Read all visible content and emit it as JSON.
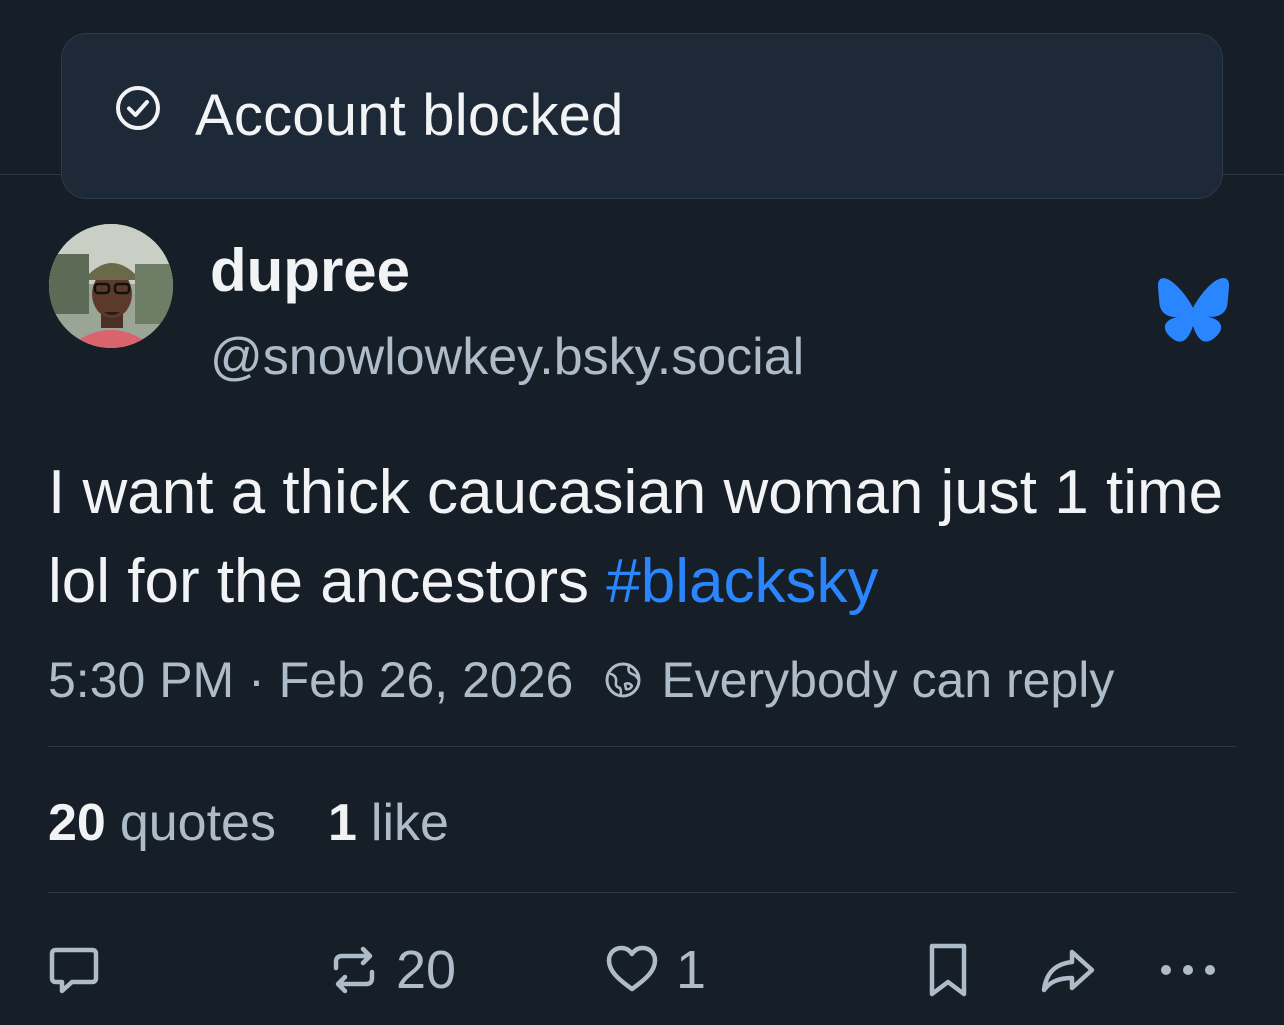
{
  "toast": {
    "icon": "check-circle-icon",
    "text": "Account blocked"
  },
  "author": {
    "display_name": "dupree",
    "handle": "@snowlowkey.bsky.social",
    "avatar": "avatar"
  },
  "brand": {
    "icon": "bluesky-butterfly-icon",
    "color": "#2a86ff"
  },
  "post": {
    "text": "I want a thick caucasian woman just 1 time lol for the ancestors ",
    "hashtag": "#blacksky"
  },
  "meta": {
    "timestamp": "5:30 PM · Feb 26, 2026",
    "reply_setting_icon": "globe-icon",
    "reply_setting": "Everybody can reply"
  },
  "stats": {
    "quotes_count": "20",
    "quotes_label": "quotes",
    "likes_count": "1",
    "likes_label": "like"
  },
  "actions": {
    "reply_icon": "reply-bubble-icon",
    "repost_icon": "repost-icon",
    "repost_count": "20",
    "like_icon": "heart-icon",
    "like_count": "1",
    "bookmark_icon": "bookmark-icon",
    "share_icon": "share-arrow-icon",
    "more_icon": "more-dots-icon"
  },
  "colors": {
    "background": "#161e27",
    "toast_bg": "#1e2937",
    "text": "#f1f3f5",
    "muted": "#aebbc9",
    "accent": "#2a86ff"
  }
}
